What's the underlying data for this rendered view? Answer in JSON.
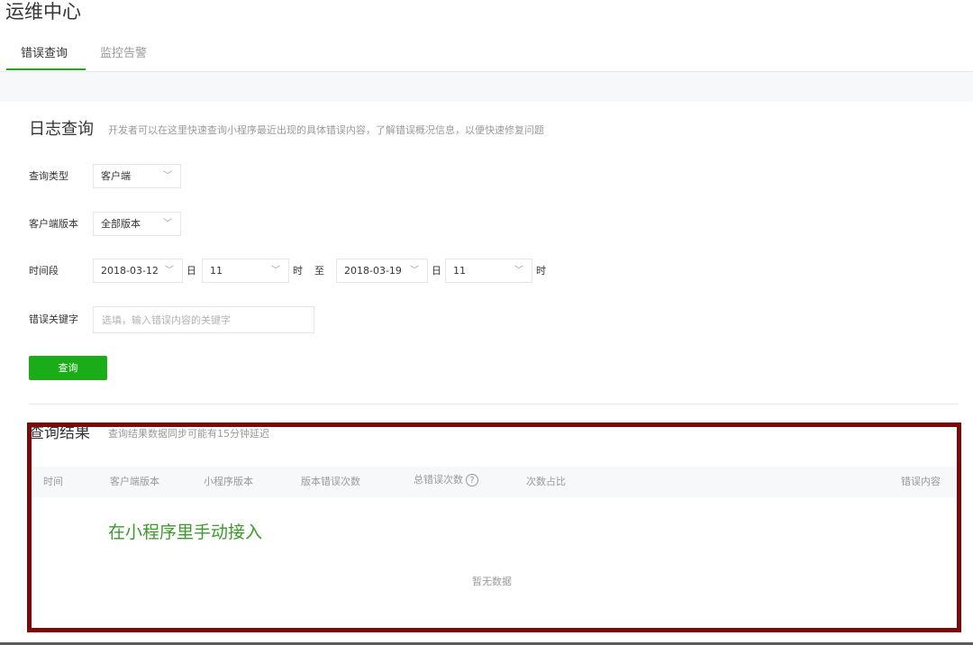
{
  "page": {
    "title": "运维中心"
  },
  "tabs": [
    {
      "label": "错误查询",
      "active": true
    },
    {
      "label": "监控告警",
      "active": false
    }
  ],
  "log_query": {
    "title": "日志查询",
    "description": "开发者可以在这里快速查询小程序最近出现的具体错误内容，了解错误概况信息，以便快速修复问题",
    "query_type": {
      "label": "查询类型",
      "value": "客户端"
    },
    "client_version": {
      "label": "客户端版本",
      "value": "全部版本"
    },
    "time_range": {
      "label": "时间段",
      "start_date": "2018-03-12",
      "start_day_unit": "日",
      "start_hour": "11",
      "start_hour_unit": "时",
      "to": "至",
      "end_date": "2018-03-19",
      "end_day_unit": "日",
      "end_hour": "11",
      "end_hour_unit": "时"
    },
    "keyword": {
      "label": "错误关键字",
      "placeholder": "选填，输入错误内容的关键字"
    },
    "query_button": "查询"
  },
  "results": {
    "title": "查询结果",
    "description": "查询结果数据同步可能有15分钟延迟",
    "columns": [
      "时间",
      "客户端版本",
      "小程序版本",
      "版本错误次数",
      "总错误次数",
      "次数占比",
      "错误内容"
    ],
    "help_icon": "question-circle-icon",
    "empty_text": "暂无数据"
  },
  "annotation": {
    "text": "在小程序里手动接入",
    "color": "#3c9a2c",
    "box_color": "#7a0a0a"
  },
  "colors": {
    "accent": "#1aad19",
    "muted_text": "#9a9a9a"
  }
}
